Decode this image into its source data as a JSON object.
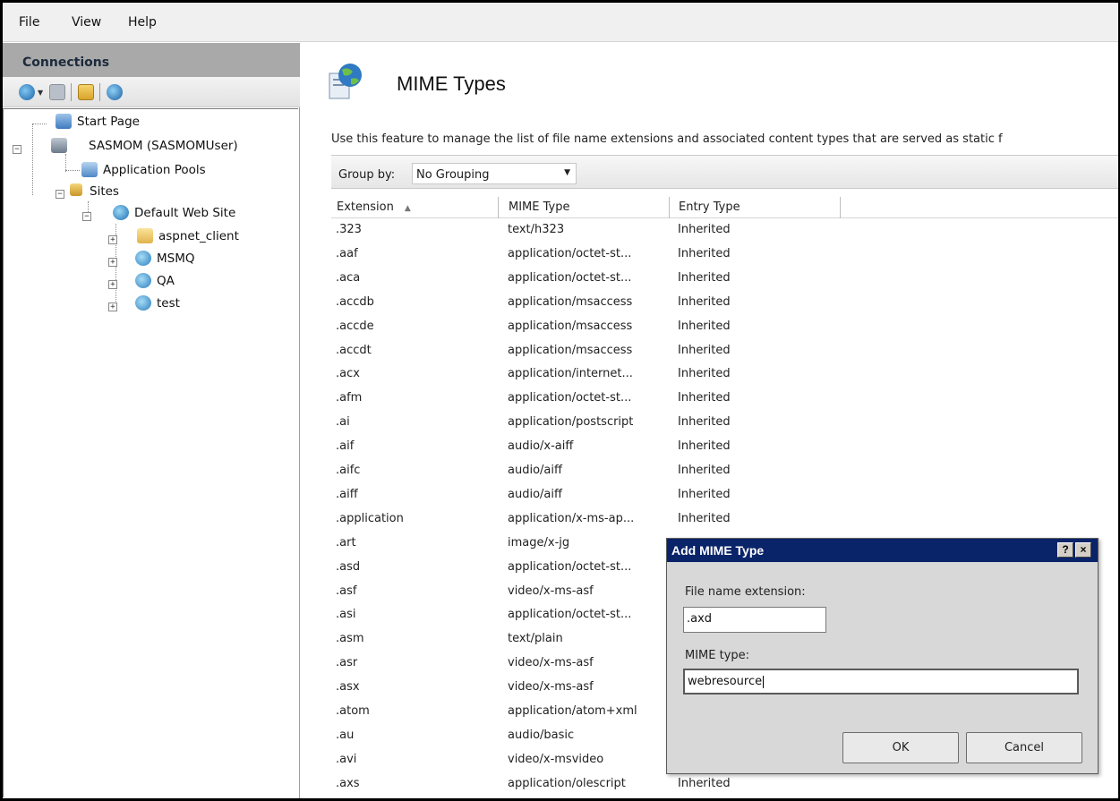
{
  "menu": [
    "File",
    "View",
    "Help"
  ],
  "connections": {
    "title": "Connections",
    "toolbar_icons": [
      "globe-connect-icon",
      "save-icon",
      "up-folder-icon",
      "disconnect-icon"
    ],
    "tree": [
      {
        "label": "Start Page",
        "icon": "start-page-icon"
      },
      {
        "label": "SASMOM (SASMOMUser)",
        "icon": "server-icon"
      },
      {
        "label": "Application Pools",
        "icon": "app-pools-icon"
      },
      {
        "label": "Sites",
        "icon": "sites-folder-icon"
      },
      {
        "label": "Default Web Site",
        "icon": "website-globe-icon"
      },
      {
        "label": "aspnet_client",
        "icon": "folder-icon"
      },
      {
        "label": "MSMQ",
        "icon": "application-icon"
      },
      {
        "label": "QA",
        "icon": "application-icon"
      },
      {
        "label": "test",
        "icon": "application-icon"
      }
    ]
  },
  "feature": {
    "title": "MIME Types",
    "description": "Use this feature to manage the list of file name extensions and associated content types that are served as static f",
    "group_by_label": "Group by:",
    "group_by_value": "No Grouping",
    "columns": [
      "Extension",
      "MIME Type",
      "Entry Type"
    ],
    "rows": [
      [
        ".323",
        "text/h323",
        "Inherited"
      ],
      [
        ".aaf",
        "application/octet-st...",
        "Inherited"
      ],
      [
        ".aca",
        "application/octet-st...",
        "Inherited"
      ],
      [
        ".accdb",
        "application/msaccess",
        "Inherited"
      ],
      [
        ".accde",
        "application/msaccess",
        "Inherited"
      ],
      [
        ".accdt",
        "application/msaccess",
        "Inherited"
      ],
      [
        ".acx",
        "application/internet...",
        "Inherited"
      ],
      [
        ".afm",
        "application/octet-st...",
        "Inherited"
      ],
      [
        ".ai",
        "application/postscript",
        "Inherited"
      ],
      [
        ".aif",
        "audio/x-aiff",
        "Inherited"
      ],
      [
        ".aifc",
        "audio/aiff",
        "Inherited"
      ],
      [
        ".aiff",
        "audio/aiff",
        "Inherited"
      ],
      [
        ".application",
        "application/x-ms-ap...",
        "Inherited"
      ],
      [
        ".art",
        "image/x-jg",
        ""
      ],
      [
        ".asd",
        "application/octet-st...",
        ""
      ],
      [
        ".asf",
        "video/x-ms-asf",
        ""
      ],
      [
        ".asi",
        "application/octet-st...",
        ""
      ],
      [
        ".asm",
        "text/plain",
        ""
      ],
      [
        ".asr",
        "video/x-ms-asf",
        ""
      ],
      [
        ".asx",
        "video/x-ms-asf",
        ""
      ],
      [
        ".atom",
        "application/atom+xml",
        ""
      ],
      [
        ".au",
        "audio/basic",
        ""
      ],
      [
        ".avi",
        "video/x-msvideo",
        ""
      ],
      [
        ".axs",
        "application/olescript",
        "Inherited"
      ]
    ]
  },
  "dialog": {
    "title": "Add MIME Type",
    "help_label": "?",
    "close_label": "×",
    "ext_label": "File name extension:",
    "ext_value": ".axd",
    "mime_label": "MIME type:",
    "mime_value": "webresource",
    "ok_label": "OK",
    "cancel_label": "Cancel"
  },
  "colors": {
    "dialog_title_bg": "#0a246a",
    "connections_header_bg": "#a9a9a9"
  }
}
